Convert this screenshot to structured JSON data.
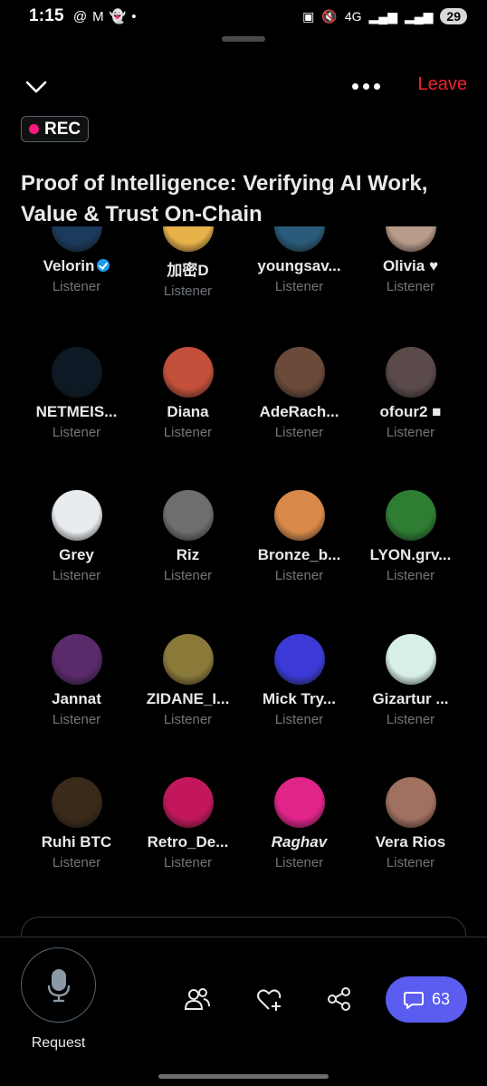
{
  "status_bar": {
    "time": "1:15",
    "network": "4G",
    "battery": "29"
  },
  "header": {
    "leave_label": "Leave",
    "rec_label": "REC",
    "title": "Proof of Intelligence: Verifying AI Work, Value & Trust On-Chain"
  },
  "participants": [
    {
      "name": "Velorin",
      "role": "Listener",
      "verified": true,
      "color": "#1b3a5c"
    },
    {
      "name": "加密D",
      "role": "Listener",
      "color": "#e8b24a"
    },
    {
      "name": "youngsav...",
      "role": "Listener",
      "color": "#2a5b7a"
    },
    {
      "name": "Olivia ♥",
      "role": "Listener",
      "color": "#b89c8a"
    },
    {
      "name": "NETMEIS...",
      "role": "Listener",
      "color": "#0d1a26"
    },
    {
      "name": "Diana",
      "role": "Listener",
      "color": "#c2503a"
    },
    {
      "name": "AdeRach...",
      "role": "Listener",
      "color": "#6b4a3a"
    },
    {
      "name": "ofour2 ■",
      "role": "Listener",
      "color": "#5a4a4a"
    },
    {
      "name": "Grey",
      "role": "Listener",
      "color": "#e9ecef"
    },
    {
      "name": "Riz",
      "role": "Listener",
      "color": "#6e6e6e"
    },
    {
      "name": "Bronze_b...",
      "role": "Listener",
      "color": "#d98a4a"
    },
    {
      "name": "LYON.grv...",
      "role": "Listener",
      "color": "#2e7d32"
    },
    {
      "name": "Jannat",
      "role": "Listener",
      "color": "#5a2a6a"
    },
    {
      "name": "ZIDANE_I...",
      "role": "Listener",
      "color": "#8a7a3a"
    },
    {
      "name": "Mick Try...",
      "role": "Listener",
      "color": "#3b3ad6"
    },
    {
      "name": "Gizartur ...",
      "role": "Listener",
      "color": "#d9f0e8"
    },
    {
      "name": "Ruhi BTC",
      "role": "Listener",
      "color": "#3a2a1a"
    },
    {
      "name": "Retro_De...",
      "role": "Listener",
      "color": "#c2185b"
    },
    {
      "name": "Raghav",
      "role": "Listener",
      "italic": true,
      "color": "#e0248a"
    },
    {
      "name": "Vera Rios",
      "role": "Listener",
      "color": "#a07060"
    }
  ],
  "bottom_bar": {
    "request_label": "Request",
    "chat_count": "63",
    "accent_color": "#5b5cf0",
    "leave_color": "#f4212e"
  }
}
